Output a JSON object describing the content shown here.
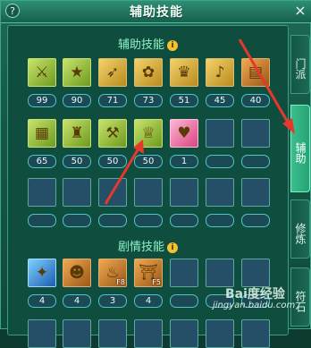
{
  "window": {
    "title": "辅助技能",
    "help_glyph": "?",
    "close_glyph": "×"
  },
  "sections": {
    "assist": {
      "title": "辅助技能",
      "info_glyph": "i"
    },
    "story": {
      "title": "剧情技能",
      "info_glyph": "i"
    }
  },
  "tabs": [
    {
      "label": "门派"
    },
    {
      "label": "辅助"
    },
    {
      "label": "修炼"
    },
    {
      "label": "符石"
    }
  ],
  "assist_row1": [
    {
      "icon": "strength-skill-icon",
      "glyph": "⚔",
      "level": "99",
      "tone": "green"
    },
    {
      "icon": "star-skill-icon",
      "glyph": "★",
      "level": "90",
      "tone": "green"
    },
    {
      "icon": "bow-skill-icon",
      "glyph": "➶",
      "level": "71",
      "tone": ""
    },
    {
      "icon": "flower-skill-icon",
      "glyph": "✿",
      "level": "73",
      "tone": ""
    },
    {
      "icon": "bell-skill-icon",
      "glyph": "♛",
      "level": "51",
      "tone": ""
    },
    {
      "icon": "gourd-skill-icon",
      "glyph": "♪",
      "level": "45",
      "tone": ""
    },
    {
      "icon": "chest-skill-icon",
      "glyph": "▤",
      "level": "40",
      "tone": "amber"
    }
  ],
  "assist_row2": [
    {
      "icon": "box-skill-icon",
      "glyph": "▦",
      "level": "65",
      "tone": "green"
    },
    {
      "icon": "armor-skill-icon",
      "glyph": "♜",
      "level": "50",
      "tone": "green"
    },
    {
      "icon": "hammer-skill-icon",
      "glyph": "⚒",
      "level": "50",
      "tone": "green"
    },
    {
      "icon": "crown-skill-icon",
      "glyph": "♕",
      "level": "50",
      "tone": "green"
    },
    {
      "icon": "heart-skill-icon",
      "glyph": "♥",
      "level": "1",
      "tone": "pink"
    }
  ],
  "story_row": [
    {
      "icon": "sword-spirit-icon",
      "glyph": "✦",
      "level": "4",
      "tone": "blue",
      "hotkey": ""
    },
    {
      "icon": "mask-skill-icon",
      "glyph": "☻",
      "level": "4",
      "tone": "amber",
      "hotkey": ""
    },
    {
      "icon": "treasure-skill-icon",
      "glyph": "♨",
      "level": "3",
      "tone": "amber",
      "hotkey": "F8"
    },
    {
      "icon": "scroll-skill-icon",
      "glyph": "⛩",
      "level": "4",
      "tone": "amber",
      "hotkey": "F5"
    }
  ],
  "watermark": {
    "site": "jingyan.baidu.com",
    "logo_text": "Bai度经验"
  },
  "colors": {
    "accent": "#8ff0c8",
    "arrow": "#e8382c"
  }
}
